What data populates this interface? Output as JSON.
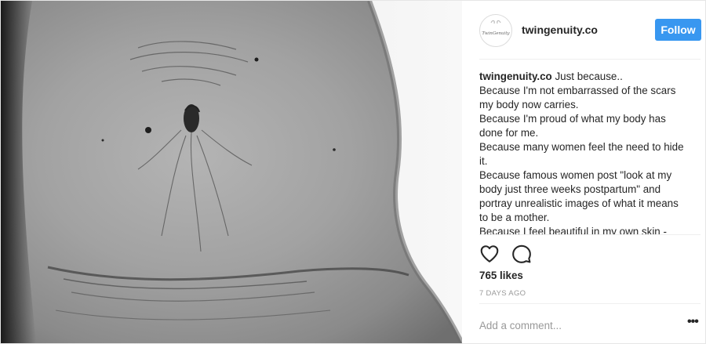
{
  "post": {
    "account": {
      "username": "twingenuity.co",
      "avatar_icon": "twingenuity-logo-icon",
      "avatar_text": "TwinGenuity"
    },
    "follow_label": "Follow",
    "caption": {
      "username": "twingenuity.co",
      "first_line": " Just because..",
      "lines": [
        "Because I'm not embarrassed of the scars",
        "my body now carries.",
        "Because I'm proud of what my body has",
        "done for me.",
        "Because many women feel the need to hide",
        "it.",
        "Because famous women post \"look at my",
        "body just three weeks postpartum\" and",
        "portray unrealistic images of what it means",
        "to be a mother.",
        "Because I feel beautiful in my own skin -"
      ]
    },
    "actions": {
      "like_icon": "heart-icon",
      "comment_icon": "comment-icon"
    },
    "likes": "765 likes",
    "timestamp": "7 DAYS AGO",
    "comment_placeholder": "Add a comment...",
    "more_icon": "more-options-icon",
    "more_label": "•••",
    "colors": {
      "follow_button": "#3897f0",
      "text": "#262626",
      "muted": "#999999",
      "divider": "#efefef"
    }
  }
}
